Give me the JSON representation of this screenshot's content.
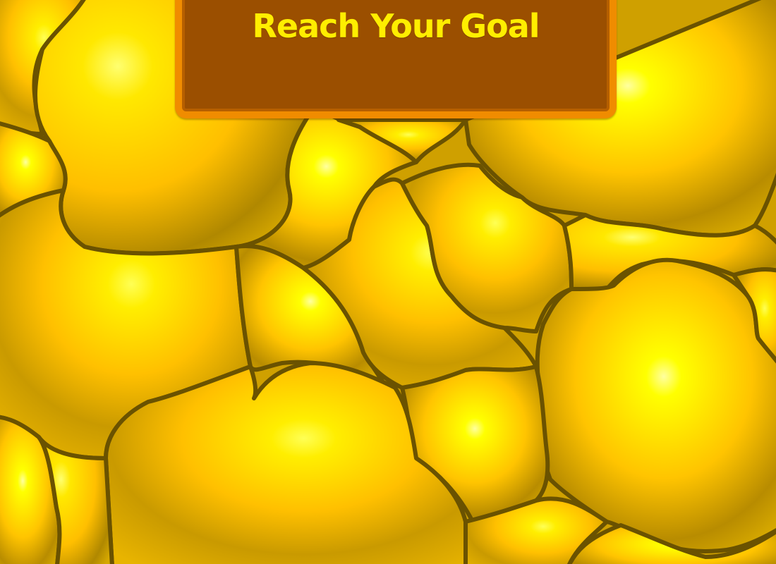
{
  "banner": {
    "title": "Reach Your Goal",
    "background_color": "#9b4f00",
    "border_color": "#f08c00",
    "text_color": "#ffee00"
  },
  "play_field": {
    "blob_fill_highlight": "#ffff30",
    "blob_fill_mid": "#ffc800",
    "blob_fill_shadow": "#b58a00",
    "blob_outline_color": "#6a5200"
  }
}
